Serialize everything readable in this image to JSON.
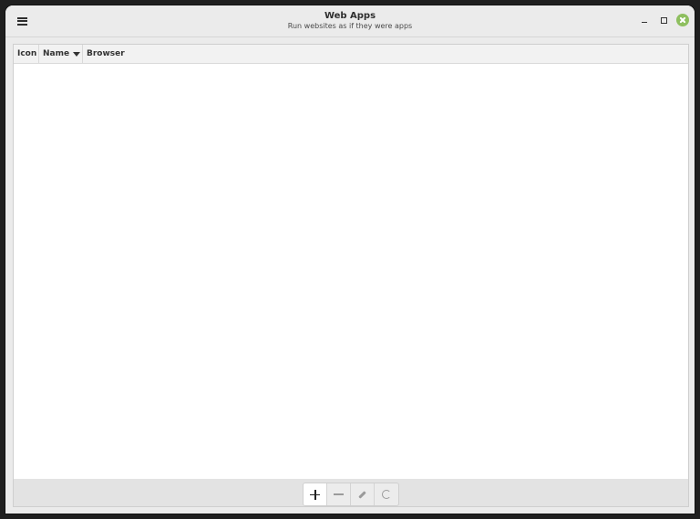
{
  "window": {
    "title": "Web Apps",
    "subtitle": "Run websites as if they were apps",
    "close_color": "#8ebf5f"
  },
  "table": {
    "columns": [
      {
        "label": "Icon"
      },
      {
        "label": "Name",
        "sort": "descending"
      },
      {
        "label": "Browser"
      }
    ],
    "rows": []
  },
  "toolbar": {
    "buttons": [
      {
        "icon": "plus-icon",
        "enabled": true
      },
      {
        "icon": "minus-icon",
        "enabled": false
      },
      {
        "icon": "pencil-icon",
        "enabled": false
      },
      {
        "icon": "refresh-icon",
        "enabled": false
      }
    ]
  },
  "icons": {
    "menu": "hamburger-menu-icon",
    "minimize": "minimize-icon",
    "maximize": "maximize-icon",
    "close": "close-icon"
  }
}
